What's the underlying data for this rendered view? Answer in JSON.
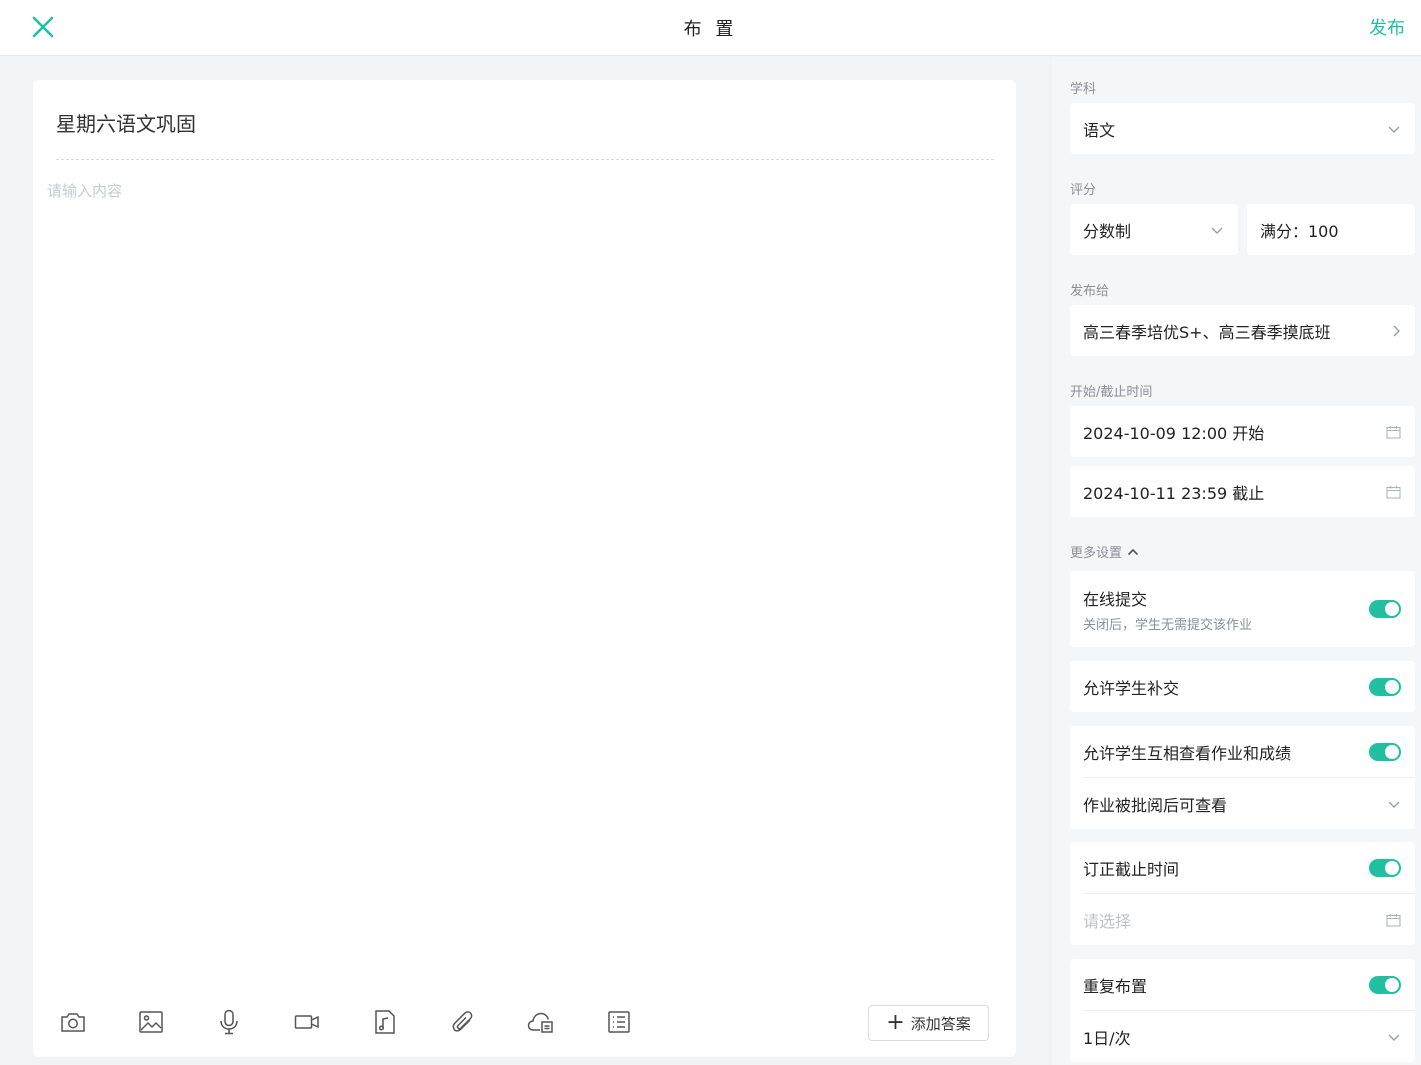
{
  "header": {
    "title": "布 置",
    "publish_label": "发布"
  },
  "editor": {
    "title": "星期六语文巩固",
    "content_placeholder": "请输入内容",
    "toolbar": [
      "camera-icon",
      "image-icon",
      "microphone-icon",
      "video-icon",
      "music-file-icon",
      "attachment-icon",
      "cloud-file-icon",
      "list-icon"
    ],
    "add_answer_label": "添加答案"
  },
  "settings": {
    "subject": {
      "label": "学科",
      "value": "语文"
    },
    "grading": {
      "label": "评分",
      "mode": "分数制",
      "full_score": "满分：100"
    },
    "publish_to": {
      "label": "发布给",
      "value": "高三春季培优S+、高三春季摸底班"
    },
    "time": {
      "label": "开始/截止时间",
      "start": "2024-10-09 12:00 开始",
      "end": "2024-10-11 23:59 截止"
    },
    "more_label": "更多设置",
    "online_submit": {
      "label": "在线提交",
      "desc": "关闭后，学生无需提交该作业",
      "on": true
    },
    "allow_late": {
      "label": "允许学生补交",
      "on": true
    },
    "peer_view": {
      "label": "允许学生互相查看作业和成绩",
      "on": true,
      "option": "作业被批阅后可查看"
    },
    "correction_deadline": {
      "label": "订正截止时间",
      "on": true,
      "placeholder": "请选择"
    },
    "repeat": {
      "label": "重复布置",
      "on": true,
      "frequency": "1日/次"
    }
  },
  "colors": {
    "accent": "#20c0a0",
    "muted": "#8a8f99",
    "placeholder": "#c7cacf"
  }
}
